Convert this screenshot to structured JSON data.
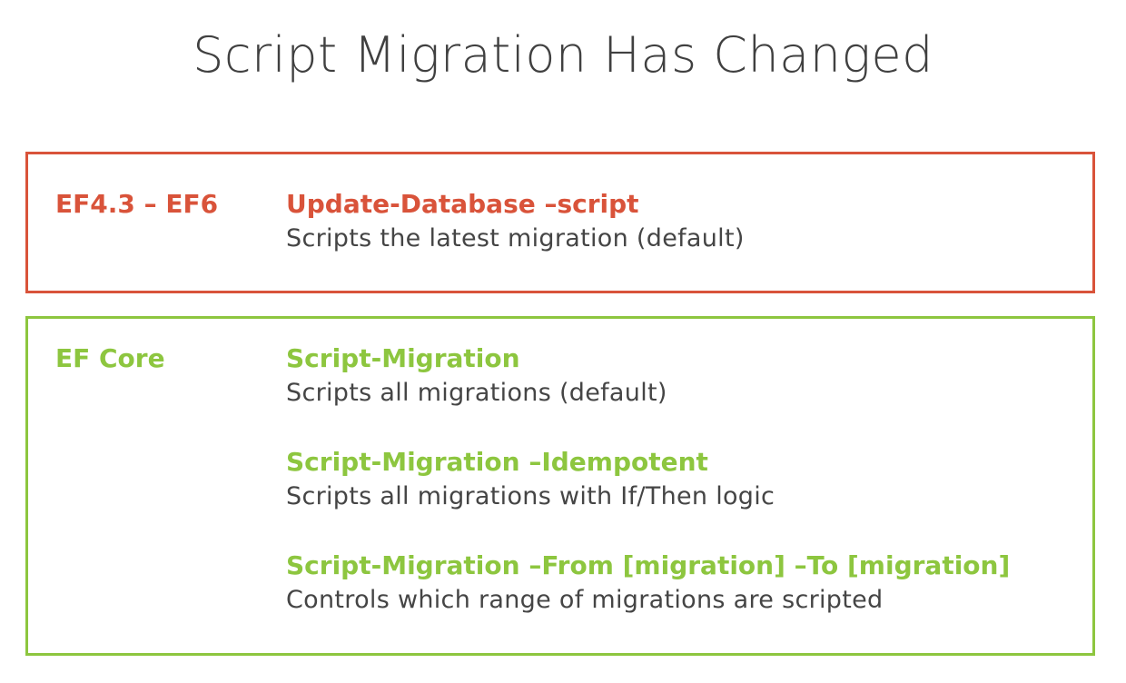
{
  "title": "Script Migration Has Changed",
  "colors": {
    "legacy_accent": "#d9533a",
    "core_accent": "#8dc63f",
    "title_text": "#404040",
    "body_text": "#454545"
  },
  "panels": [
    {
      "version": "EF4.3 – EF6",
      "entries": [
        {
          "command": "Update-Database –script",
          "description": "Scripts the latest migration (default)"
        }
      ]
    },
    {
      "version": "EF Core",
      "entries": [
        {
          "command": "Script-Migration",
          "description": "Scripts all migrations (default)"
        },
        {
          "command": "Script-Migration –Idempotent",
          "description": "Scripts all migrations with If/Then logic"
        },
        {
          "command": "Script-Migration –From [migration] –To [migration]",
          "description": "Controls which range of migrations are scripted"
        }
      ]
    }
  ]
}
